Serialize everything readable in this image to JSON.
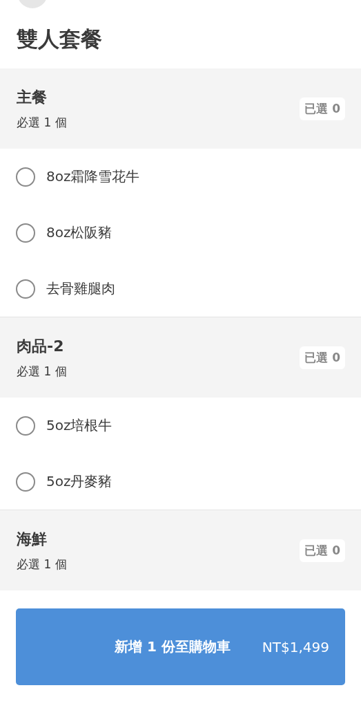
{
  "title": "雙人套餐",
  "groups": [
    {
      "name": "主餐",
      "rule": "必選 1 個",
      "selected_count": "已選 0",
      "options": [
        {
          "label": "8oz霜降雪花牛",
          "selected": false
        },
        {
          "label": "8oz松阪豬",
          "selected": false
        },
        {
          "label": "去骨雞腿肉",
          "selected": false
        }
      ]
    },
    {
      "name": "肉品-2",
      "rule": "必選 1 個",
      "selected_count": "已選 0",
      "options": [
        {
          "label": "5oz培根牛",
          "selected": false
        },
        {
          "label": "5oz丹麥豬",
          "selected": false
        }
      ]
    },
    {
      "name": "海鮮",
      "rule": "必選 1 個",
      "selected_count": "已選 0"
    }
  ],
  "add_button": {
    "label": "新增 1 份至購物車",
    "price": "NT$1,499"
  }
}
